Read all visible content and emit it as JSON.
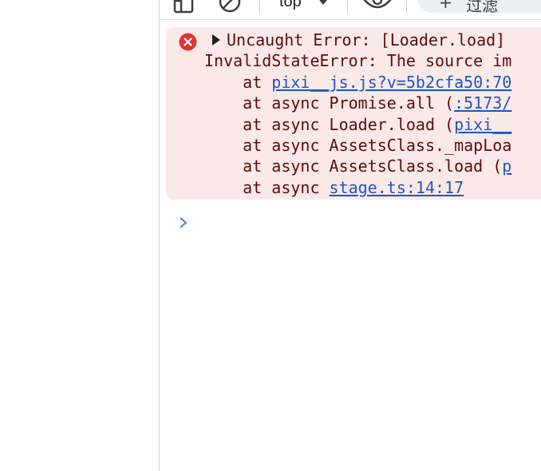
{
  "toolbar": {
    "context_label": "top",
    "filter_label": "过滤"
  },
  "console": {
    "error": {
      "summary": "Uncaught Error: [Loader.load]",
      "message": "InvalidStateError: The source im",
      "stack": [
        {
          "prefix": "    at ",
          "link": "pixi__js.js?v=5b2cfa50:70",
          "open": "",
          "suffix": ""
        },
        {
          "prefix": "    at async Promise.all ",
          "open": "(",
          "link": ":5173/",
          "suffix": ""
        },
        {
          "prefix": "    at async Loader.load ",
          "open": "(",
          "link": "pixi__",
          "suffix": ""
        },
        {
          "prefix": "    at async AssetsClass._mapLoa",
          "open": "",
          "link": "",
          "suffix": ""
        },
        {
          "prefix": "    at async AssetsClass.load ",
          "open": "(",
          "link": "p",
          "suffix": ""
        },
        {
          "prefix": "    at async ",
          "open": "",
          "link": "stage.ts:14:17",
          "suffix": ""
        }
      ]
    }
  },
  "icons": {
    "toolbar": [
      "sidebar-toggle-icon",
      "clear-console-icon",
      "eye-icon"
    ],
    "error": "error-circle-icon",
    "prompt": "chevron-right-icon"
  },
  "colors": {
    "error_background": "#fbe9e8",
    "error_text": "#5d0b0b",
    "link": "#1a57c8",
    "error_icon": "#dc362e",
    "prompt": "#4a7fd8"
  }
}
